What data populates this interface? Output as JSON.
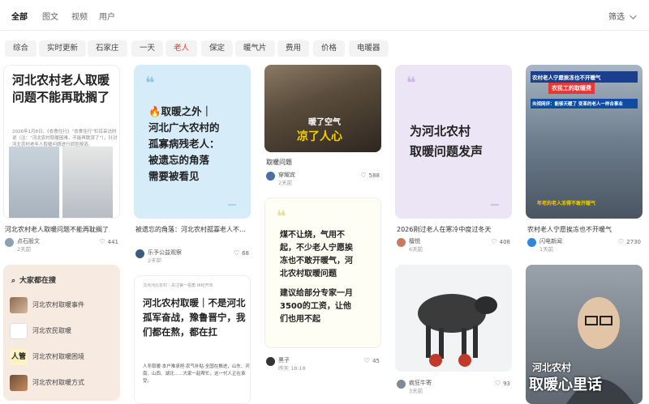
{
  "top_tabs": [
    "全部",
    "图文",
    "视频",
    "用户"
  ],
  "filter_label": "筛选",
  "chips": [
    "综合",
    "实时更新",
    "石家庄",
    "一天",
    "老人",
    "保定",
    "暖气片",
    "费用",
    "价格",
    "电暖器"
  ],
  "active_chip": "老人",
  "cards": {
    "c1": {
      "headline": "河北农村老人取暖问题不能再耽搁了",
      "snippet": "2026年1月8日，《衣食住行》“衣食住行”栏目采访时说（注：“河北农村取暖困难，不能再耽误了”），针对河北农村老年人取暖问题进行调查报道。",
      "title": "河北农村老人取暖问题不能再耽搁了",
      "author": "点石股文",
      "time": "2天前",
      "likes": "441"
    },
    "c2": {
      "lines": [
        "🔥取暖之外｜",
        "河北广大农村的",
        "孤寡病残老人：",
        "被遗忘的角落",
        "需要被看见"
      ],
      "title": "被遗忘的角落：河北农村孤寡老人不止于取暖",
      "author": "乐予公益观察",
      "time": "2天前",
      "likes": "68"
    },
    "c3": {
      "overlay_top": "暖了空气",
      "overlay_bottom": "凉了人心",
      "title": "取暖问题",
      "author": "穿耀宾",
      "time": "2天前",
      "likes": "588"
    },
    "c4": {
      "lines": [
        "煤不让烧，气用不",
        "起，不少老人宁愿挨",
        "冻也不敢开暖气，河",
        "北农村取暖问题"
      ],
      "lines2": [
        "建议给部分专家一月",
        "3500的工资，让他",
        "们也用不起"
      ],
      "author": "黑子",
      "time": "昨天 18:18",
      "likes": "45"
    },
    "c5": {
      "lines": [
        "为河北农村",
        "取暖问题发声"
      ],
      "title": "2026刚过老人在寒冷中度过冬天",
      "author": "檀悦",
      "time": "6天前",
      "likes": "408"
    },
    "c6": {
      "header": "汉点河北农村｜关注第一视角 世纪开年",
      "body": "河北农村取暖｜不是河北孤军奋战，豫鲁晋宁，我们都在熬，都在扛",
      "body2": "人冬取暖·本户难承担·农气补贴·全国在推进，山东、河南、山西、湖北……大家一起帮忙，这一代人正在承受。"
    },
    "c7": {
      "title": "",
      "author": "疯狂牛寄",
      "time": "3天前",
      "likes": "93"
    },
    "c8": {
      "banner1": "农村老人宁愿挨冻也不开暖气",
      "banner2": "农民工的取暖费",
      "banner3": "央视网评：能够天暖了 变革的老人一样合事业",
      "caption": "年老的老人冻得不敢开暖气",
      "title": "农村老人宁愿挨冻也不开暖气",
      "author": "闪电新闻",
      "time": "1天前",
      "likes": "2730"
    },
    "c9": {
      "overlay_top": "河北农村",
      "overlay_bottom": "取暖心里话"
    }
  },
  "search_box": {
    "title": "大家都在搜",
    "items": [
      "河北农村取暖事件",
      "河北农民取暖",
      "河北农村取暖困境",
      "河北农村取暖方式"
    ],
    "thumb_text": "人管"
  },
  "colors": {
    "accent": "#e53935",
    "card2_bg": "#d6ecf8",
    "card5_bg": "#ece5f6",
    "card4_bg": "#fffef5",
    "search_bg": "#f7ebe1",
    "highlight_yellow": "#f5d000",
    "highlight_green": "#2e8b3a"
  },
  "icons": {
    "heart": "heart-icon",
    "search": "search-icon",
    "quote": "quote-icon",
    "chevron": "chevron-down-icon"
  }
}
